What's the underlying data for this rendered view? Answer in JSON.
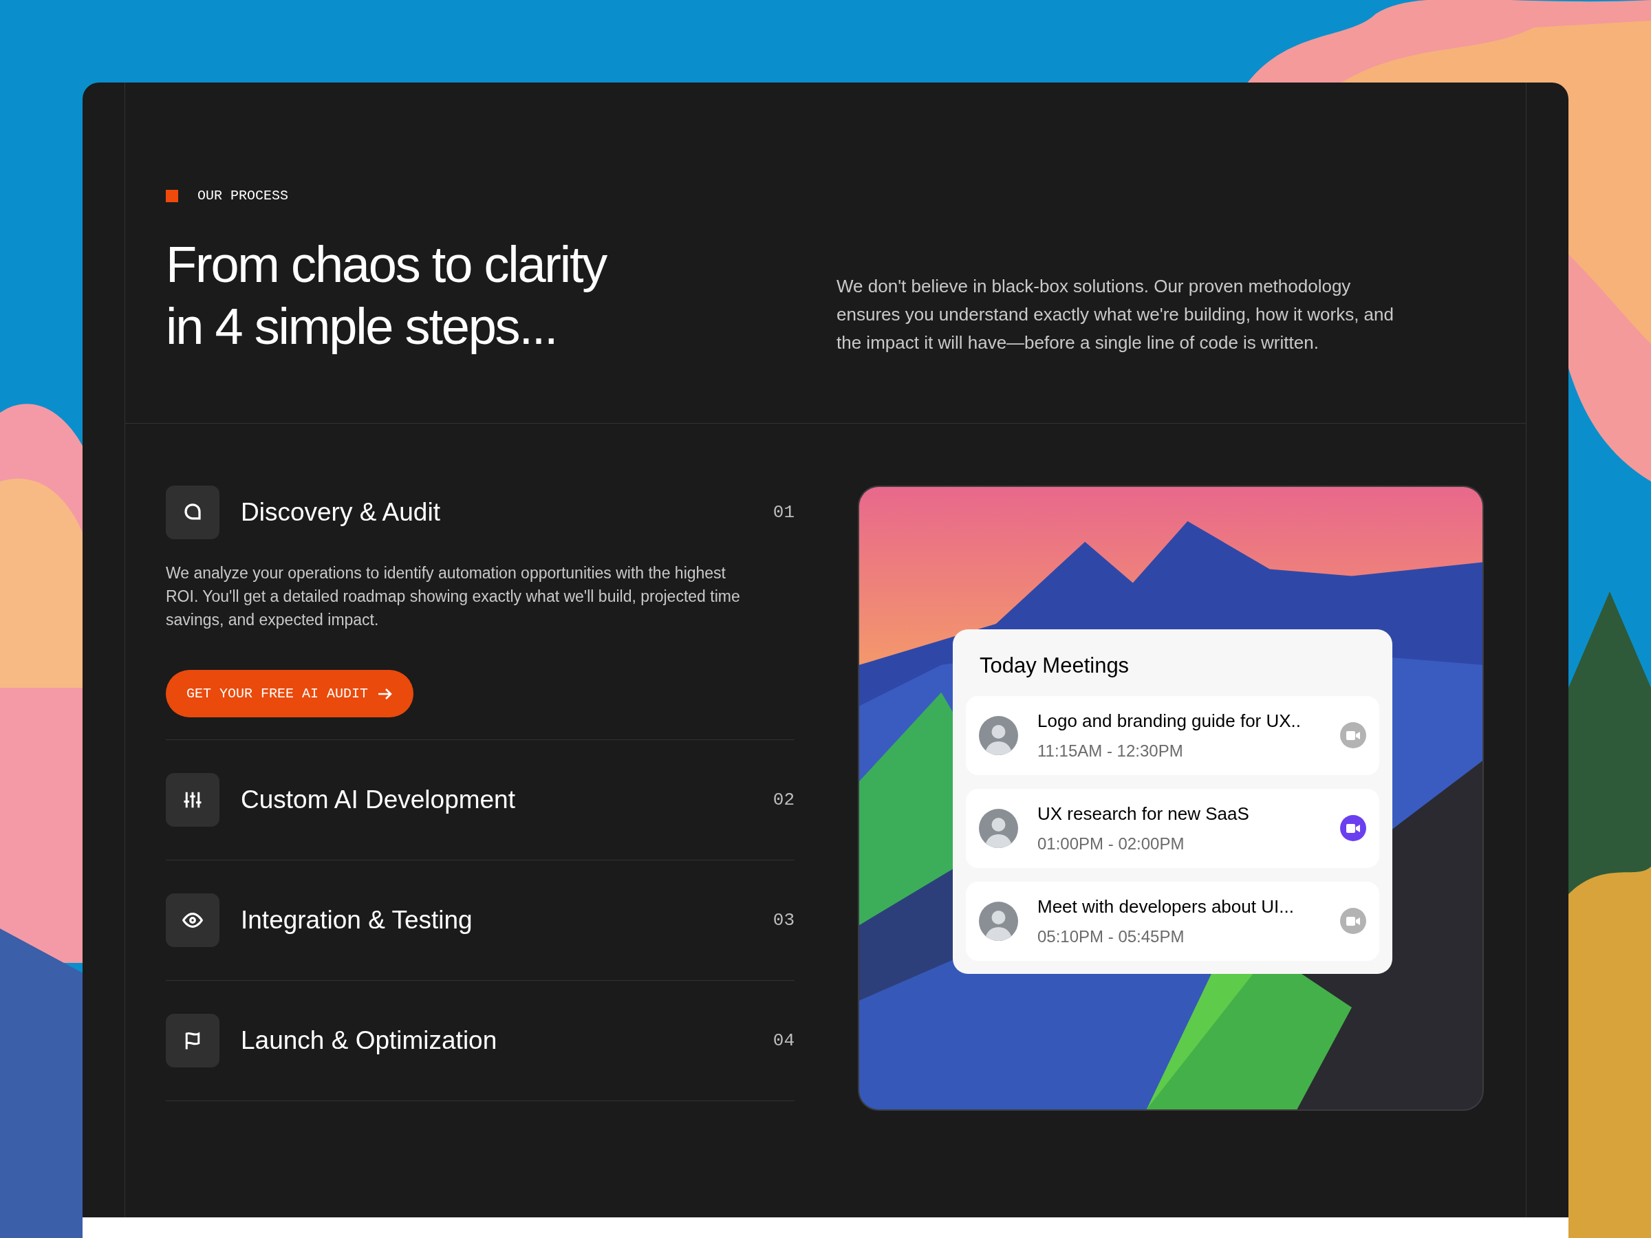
{
  "eyebrow": "OUR PROCESS",
  "headline": [
    "From chaos to clarity",
    "in 4 simple steps..."
  ],
  "intro": "We don't believe in black-box solutions. Our proven methodology ensures you understand exactly what we're building, how it works, and the impact it will have—before a single line of code is written.",
  "steps": [
    {
      "title": "Discovery & Audit",
      "number": "01",
      "expanded": true,
      "description": "We analyze your operations to identify automation opportunities with the highest ROI. You'll get a detailed roadmap showing exactly what we'll build, projected time savings, and expected impact.",
      "button": "GET YOUR FREE AI AUDIT"
    },
    {
      "title": "Custom AI Development",
      "number": "02",
      "expanded": false
    },
    {
      "title": "Integration & Testing",
      "number": "03",
      "expanded": false
    },
    {
      "title": "Launch & Optimization",
      "number": "04",
      "expanded": false
    }
  ],
  "meetings": {
    "title": "Today Meetings",
    "items": [
      {
        "title": "Logo and branding guide for UX..",
        "time": "11:15AM - 12:30PM",
        "call_active": false
      },
      {
        "title": "UX research for new SaaS",
        "time": "01:00PM - 02:00PM",
        "call_active": true
      },
      {
        "title": "Meet with developers about UI...",
        "time": "05:10PM - 05:45PM",
        "call_active": false
      }
    ]
  }
}
